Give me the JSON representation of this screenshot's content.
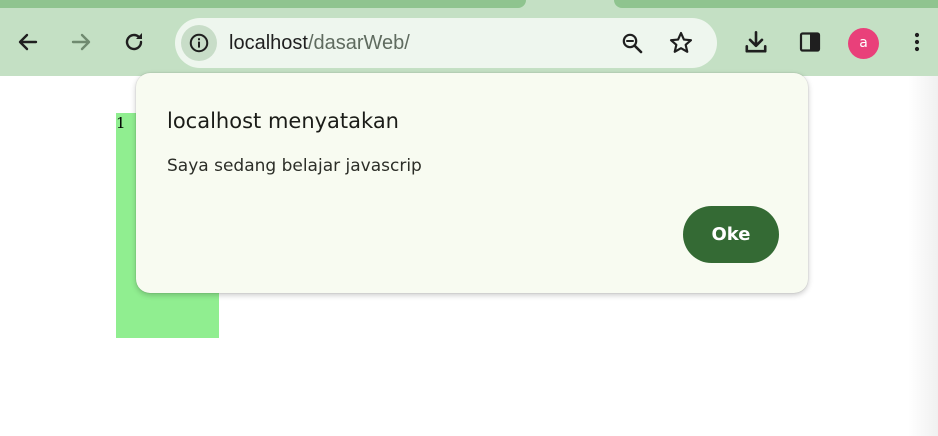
{
  "browser": {
    "address_bar": {
      "host": "localhost",
      "path": "/dasarWeb/"
    },
    "profile_initial": "a",
    "colors": {
      "toolbar": "#c4e0c4",
      "omnibox": "#eef6ee",
      "avatar": "#e9407a"
    },
    "icons": {
      "back": "back-arrow-icon",
      "forward": "forward-arrow-icon",
      "reload": "reload-icon",
      "site_info": "info-icon",
      "zoom": "zoom-icon",
      "bookmark": "star-icon",
      "downloads": "download-icon",
      "side_panel": "side-panel-icon",
      "menu": "kebab-menu-icon"
    }
  },
  "page": {
    "box_label": "1",
    "box_color": "#90ee90"
  },
  "alert_dialog": {
    "title": "localhost menyatakan",
    "message": "Saya sedang belajar javascrip",
    "ok_label": "Oke",
    "colors": {
      "background": "#f8fbf1",
      "button": "#346a34"
    }
  }
}
